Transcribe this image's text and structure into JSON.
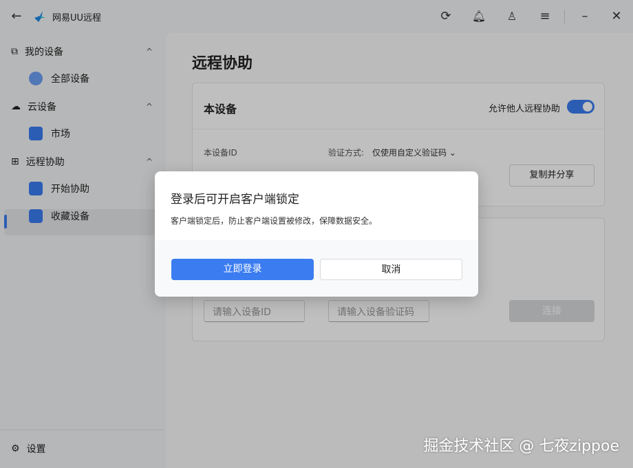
{
  "app": {
    "title": "网易UU远程",
    "accent": "#3b7cf0"
  },
  "titlebar": {
    "icons": [
      "back-arrow-icon",
      "refresh-icon",
      "bell-icon",
      "user-icon",
      "menu-icon",
      "minimize-icon",
      "close-icon"
    ]
  },
  "sidebar": {
    "groups": [
      {
        "label": "我的设备",
        "items": [
          {
            "label": "全部设备"
          }
        ]
      },
      {
        "label": "云设备",
        "items": [
          {
            "label": "市场"
          }
        ]
      },
      {
        "label": "远程协助",
        "items": [
          {
            "label": "开始协助"
          },
          {
            "label": "收藏设备"
          }
        ]
      }
    ],
    "settings": "设置"
  },
  "main": {
    "title": "远程协助",
    "device_card": {
      "title": "本设备",
      "allow_label": "允许他人远程协助",
      "allow_enabled": true,
      "id_label": "本设备ID",
      "verify_label": "验证方式:",
      "verify_value": "仅使用自定义验证码",
      "copy_share": "复制并分享"
    },
    "connect": {
      "id_placeholder": "请输入设备ID",
      "code_placeholder": "请输入设备验证码",
      "connect_button": "连接"
    }
  },
  "dialog": {
    "title": "登录后可开启客户端锁定",
    "text": "客户端锁定后，防止客户端设置被修改，保障数据安全。",
    "confirm": "立即登录",
    "cancel": "取消"
  },
  "watermark": "掘金技术社区 @ 七夜zippoe"
}
